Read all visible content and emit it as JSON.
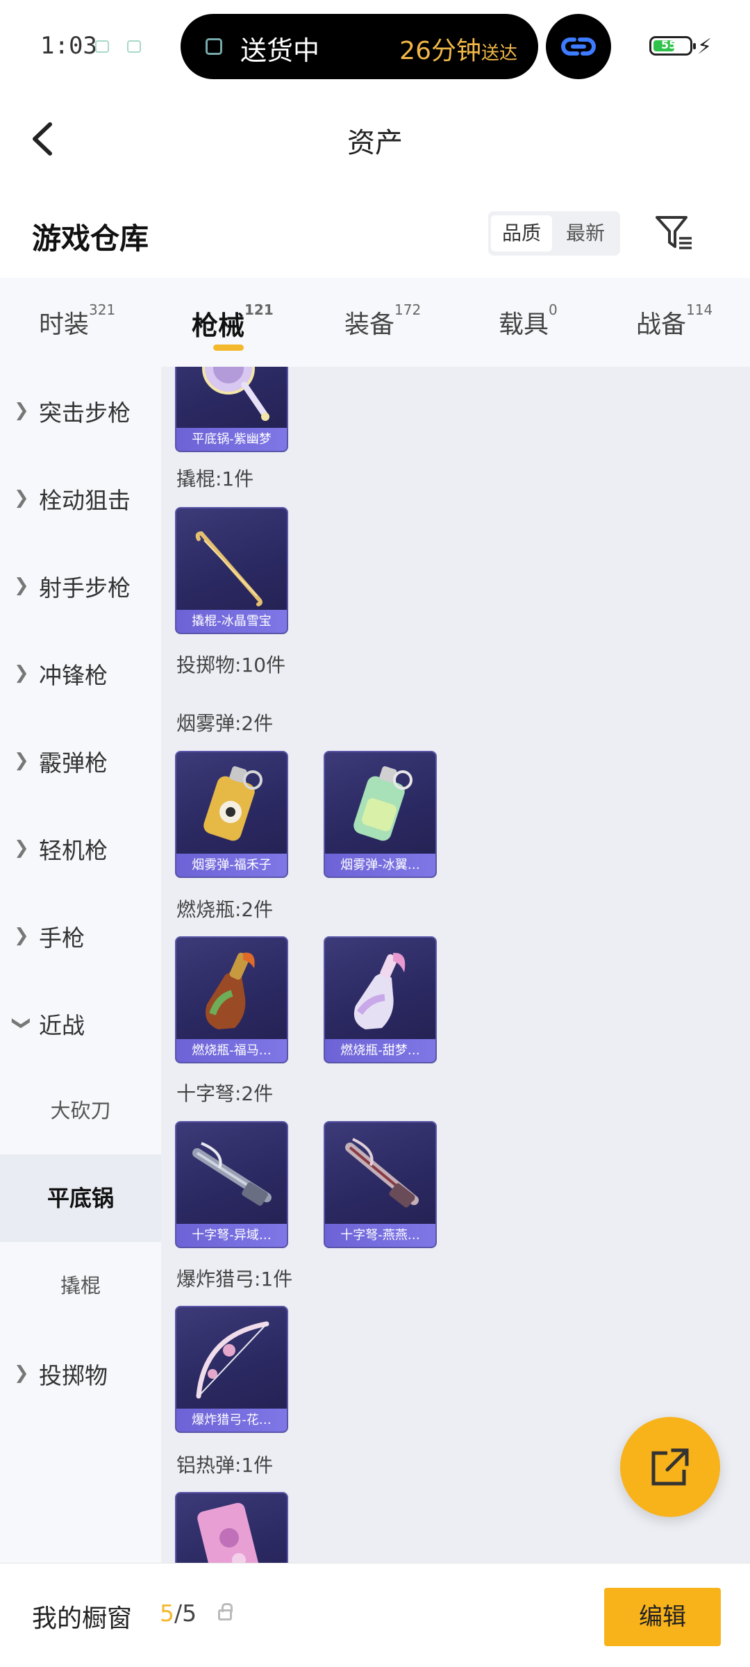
{
  "status_bar": {
    "time": "1:03",
    "delivery_status": "送货中",
    "eta": "26分钟",
    "eta_suffix": "送达",
    "battery": "55"
  },
  "header": {
    "title": "资产"
  },
  "warehouse": {
    "title": "游戏仓库",
    "sort_options": [
      "品质",
      "最新"
    ]
  },
  "tabs": [
    {
      "label": "时装",
      "count": "321"
    },
    {
      "label": "枪械",
      "count": "121"
    },
    {
      "label": "装备",
      "count": "172"
    },
    {
      "label": "载具",
      "count": "0"
    },
    {
      "label": "战备",
      "count": "114"
    }
  ],
  "sidebar": {
    "items": [
      "突击步枪",
      "栓动狙击",
      "射手步枪",
      "冲锋枪",
      "霰弹枪",
      "轻机枪",
      "手枪",
      "近战"
    ],
    "melee_subitems": [
      "大砍刀",
      "平底锅",
      "撬棍"
    ],
    "last_item": "投掷物"
  },
  "content": {
    "groups": [
      {
        "label": "撬棍:1件"
      },
      {
        "label": "投掷物:10件"
      },
      {
        "label": "烟雾弹:2件"
      },
      {
        "label": "燃烧瓶:2件"
      },
      {
        "label": "十字弩:2件"
      },
      {
        "label": "爆炸猎弓:1件"
      },
      {
        "label": "铝热弹:1件"
      }
    ],
    "cards": [
      {
        "caption": "平底锅-紫幽梦",
        "icon": "frying-pan"
      },
      {
        "caption": "撬棍-冰晶雪宝",
        "icon": "crowbar"
      },
      {
        "caption": "烟雾弹-福禾子",
        "icon": "smoke-grenade"
      },
      {
        "caption": "烟雾弹-冰翼…",
        "icon": "smoke-grenade"
      },
      {
        "caption": "燃烧瓶-福马…",
        "icon": "molotov"
      },
      {
        "caption": "燃烧瓶-甜梦…",
        "icon": "molotov"
      },
      {
        "caption": "十字弩-异域…",
        "icon": "crossbow"
      },
      {
        "caption": "十字弩-燕燕…",
        "icon": "crossbow"
      },
      {
        "caption": "爆炸猎弓-花…",
        "icon": "bow"
      },
      {
        "caption": "",
        "icon": "thermite-grenade"
      }
    ]
  },
  "bottom_bar": {
    "label": "我的橱窗",
    "current": "5",
    "total": "/5",
    "edit_label": "编辑"
  },
  "colors": {
    "accent": "#f8b21a",
    "card_bg": "#2a2860",
    "card_caption": "#7369dc"
  }
}
